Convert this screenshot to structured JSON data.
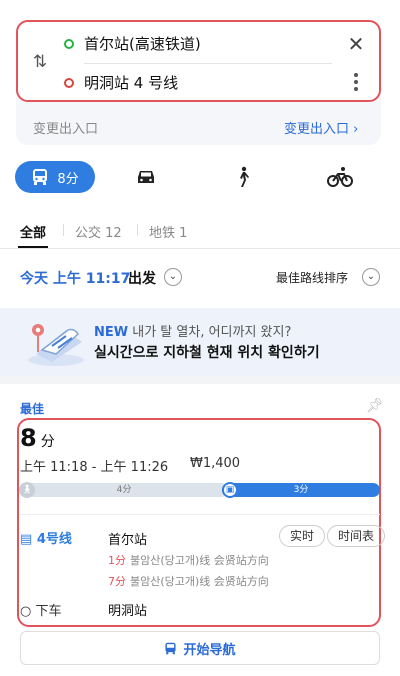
{
  "route": {
    "start": "首尔站(高速铁道)",
    "end": "明洞站 4 号线",
    "exit_left": "变更出入口",
    "exit_right": "变更出入口 ›"
  },
  "modes": {
    "transit_time": "8分"
  },
  "filter_tabs": {
    "all": "全部",
    "bus": "公交 12",
    "subway": "地铁 1"
  },
  "departure": {
    "text": "今天 上午 11:17",
    "suffix": "出发",
    "sort": "最佳路线排序"
  },
  "banner": {
    "new_tag": "NEW",
    "title": "내가 탈 열차, 어디까지 왔지?",
    "subtitle": "실시간으로 지하철 현재 위치 확인하기"
  },
  "result": {
    "tag": "最佳",
    "duration_num": "8",
    "duration_unit": "分",
    "time_range": "上午 11:18 - 上午 11:26",
    "fare": "₩1,400",
    "walk_label": "4分",
    "metro_label": "3分",
    "walk_share": 0.53,
    "line": "4号线",
    "board_station": "首尔站",
    "realtime_btn": "实时",
    "timetable_btn": "时间表",
    "arrivals": [
      {
        "min": "1分",
        "desc": "불암산(당고개)线  会贤站方向"
      },
      {
        "min": "7分",
        "desc": "불암산(당고개)线  会贤站方向"
      }
    ],
    "alight_label": "下车",
    "alight_station": "明洞站",
    "nav_button": "开始导航"
  },
  "colors": {
    "accent": "#2f7de1",
    "highlight_border": "#e2535a",
    "start_dot": "#26b14a",
    "end_dot": "#d4463e"
  }
}
